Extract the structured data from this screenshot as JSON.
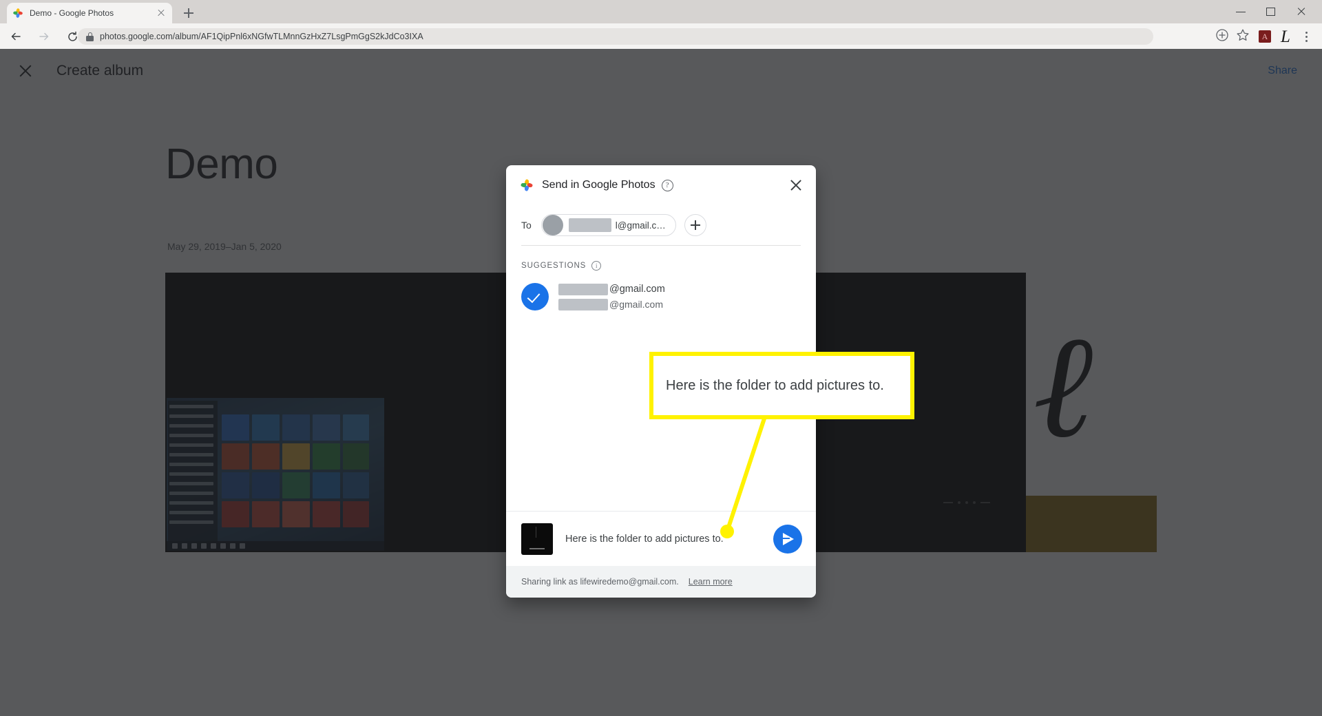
{
  "browser": {
    "tab": {
      "title": "Demo - Google Photos",
      "favicon_icon": "google-photos-favicon",
      "close_icon": "close-icon"
    },
    "newtab_icon": "plus-icon",
    "back_icon": "back-arrow-icon",
    "forward_icon": "forward-arrow-icon",
    "reload_icon": "reload-icon",
    "lock_icon": "lock-icon",
    "url": "photos.google.com/album/AF1QipPnl6xNGfwTLMnnGzHxZ7LsgPmGgS2kJdCo3IXA",
    "toolbar_icons": [
      "share-circle-icon",
      "bookmark-star-icon",
      "adobe-acrobat-extension-icon",
      "profile-avatar",
      "chrome-menu-icon"
    ],
    "window_controls": [
      "minimize-button",
      "maximize-button",
      "close-window-button"
    ]
  },
  "appbar": {
    "close_icon": "close-icon",
    "title": "Create album",
    "share_label": "Share"
  },
  "album": {
    "title": "Demo",
    "date_range": "May 29, 2019–Jan 5, 2020"
  },
  "dialog": {
    "logo_icon": "google-photos-pinwheel-icon",
    "title": "Send in Google Photos",
    "help_icon": "help-circle-icon",
    "help_glyph": "?",
    "close_icon": "close-icon",
    "to": {
      "label": "To",
      "chip_avatar": "contact-avatar-redacted",
      "chip_text": "l@gmail.c…",
      "add_icon": "plus-icon"
    },
    "suggestions": {
      "label": "SUGGESTIONS",
      "info_icon": "info-circle-icon",
      "info_glyph": "i",
      "items": [
        {
          "selected": true,
          "check_icon": "check-circle-selected-icon",
          "primary": "@gmail.com",
          "secondary": "@gmail.com"
        }
      ]
    },
    "compose": {
      "thumbnail_icon": "album-thumbnail",
      "message": "Here is the folder to add pictures to.",
      "send_icon": "send-paper-plane-icon"
    },
    "footer": {
      "text": "Sharing link as lifewiredemo@gmail.com.",
      "link_label": "Learn more"
    }
  },
  "annotation": {
    "callout_text": "Here is the folder to add pictures to.",
    "highlight_color": "#fff200",
    "leader_color": "#fff200"
  },
  "colors": {
    "accent_blue": "#1a73e8",
    "scrim": "rgba(32,33,36,.75)",
    "dialog_bg": "#ffffff",
    "page_bg": "#ffffff",
    "highlight_yellow": "#fff200"
  }
}
